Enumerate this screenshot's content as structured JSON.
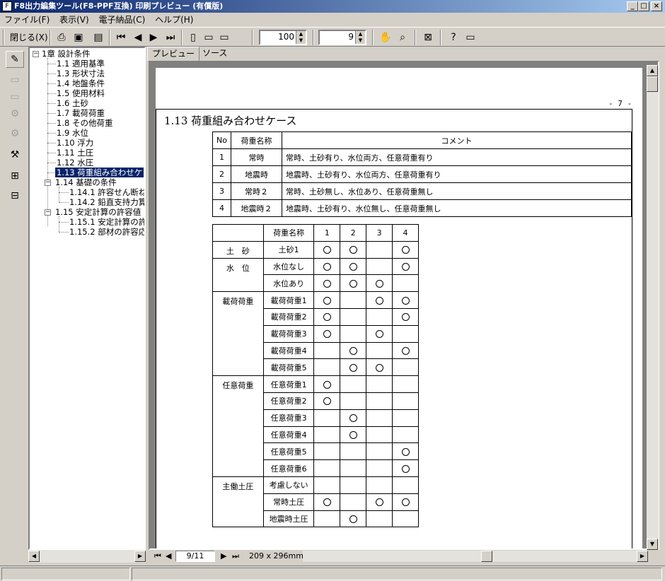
{
  "window": {
    "title": "F8出力編集ツール(F8-PPF互換) 印刷プレビュー (有償版)",
    "controls": [
      "_",
      "□",
      "×"
    ]
  },
  "menu": [
    "ファイル(F)",
    "表示(V)",
    "電子納品(C)",
    "ヘルプ(H)"
  ],
  "toolbar": {
    "close_label": "閉じる(X)",
    "zoom": "100",
    "page": "9"
  },
  "tree": {
    "root": "1章 設計条件",
    "items": [
      "1.1 適用基準",
      "1.3 形状寸法",
      "1.4 地盤条件",
      "1.5 使用材料",
      "1.6 土砂",
      "1.7 載荷荷重",
      "1.8 その他荷重",
      "1.9 水位",
      "1.10 浮力",
      "1.11 土圧",
      "1.12 水圧",
      "1.13 荷重組み合わせケ"
    ],
    "g14": "1.14 基礎の条件",
    "g14_items": [
      "1.14.1 許容せん断ね",
      "1.14.2 鉛直支持力算"
    ],
    "g15": "1.15 安定計算の許容値",
    "g15_items": [
      "1.15.1 安定計算の許",
      "1.15.2 部材の許容応"
    ]
  },
  "tabs": [
    "プレビュー",
    "ソース"
  ],
  "document": {
    "page_marker": "- 7 -",
    "section_title": "1.13 荷重組み合わせケース",
    "table1": {
      "headers": [
        "No",
        "荷重名称",
        "コメント"
      ],
      "rows": [
        [
          "1",
          "常時",
          "常時、土砂有り、水位両方、任意荷重有り"
        ],
        [
          "2",
          "地震時",
          "地震時、土砂有り、水位両方、任意荷重有り"
        ],
        [
          "3",
          "常時２",
          "常時、土砂無し、水位あり、任意荷重無し"
        ],
        [
          "4",
          "地震時２",
          "地震時、土砂有り、水位無し、任意荷重無し"
        ]
      ]
    },
    "table2": {
      "headers": [
        "",
        "荷重名称",
        "1",
        "2",
        "3",
        "4"
      ],
      "groups": [
        {
          "name": "土　砂",
          "rows": [
            {
              "name": "土砂1",
              "marks": [
                1,
                1,
                0,
                1
              ]
            }
          ]
        },
        {
          "name": "水　位",
          "rows": [
            {
              "name": "水位なし",
              "marks": [
                1,
                1,
                0,
                1
              ]
            },
            {
              "name": "水位あり",
              "marks": [
                1,
                1,
                1,
                0
              ]
            }
          ]
        },
        {
          "name": "載荷荷重",
          "rows": [
            {
              "name": "載荷荷重1",
              "marks": [
                1,
                0,
                1,
                1
              ]
            },
            {
              "name": "載荷荷重2",
              "marks": [
                1,
                0,
                0,
                1
              ]
            },
            {
              "name": "載荷荷重3",
              "marks": [
                1,
                0,
                1,
                0
              ]
            },
            {
              "name": "載荷荷重4",
              "marks": [
                0,
                1,
                0,
                1
              ]
            },
            {
              "name": "載荷荷重5",
              "marks": [
                0,
                1,
                1,
                0
              ]
            }
          ]
        },
        {
          "name": "任意荷重",
          "rows": [
            {
              "name": "任意荷重1",
              "marks": [
                1,
                0,
                0,
                0
              ]
            },
            {
              "name": "任意荷重2",
              "marks": [
                1,
                0,
                0,
                0
              ]
            },
            {
              "name": "任意荷重3",
              "marks": [
                0,
                1,
                0,
                0
              ]
            },
            {
              "name": "任意荷重4",
              "marks": [
                0,
                1,
                0,
                0
              ]
            },
            {
              "name": "任意荷重5",
              "marks": [
                0,
                0,
                0,
                1
              ]
            },
            {
              "name": "任意荷重6",
              "marks": [
                0,
                0,
                0,
                1
              ]
            }
          ]
        },
        {
          "name": "主働土圧",
          "rows": [
            {
              "name": "考慮しない",
              "marks": [
                0,
                0,
                0,
                0
              ]
            },
            {
              "name": "常時土圧",
              "marks": [
                1,
                0,
                1,
                1
              ]
            },
            {
              "name": "地震時土圧",
              "marks": [
                0,
                1,
                0,
                0
              ]
            }
          ]
        }
      ]
    }
  },
  "navigation": {
    "page_indicator": "9/11",
    "paper_size": "209 x 296mm"
  }
}
